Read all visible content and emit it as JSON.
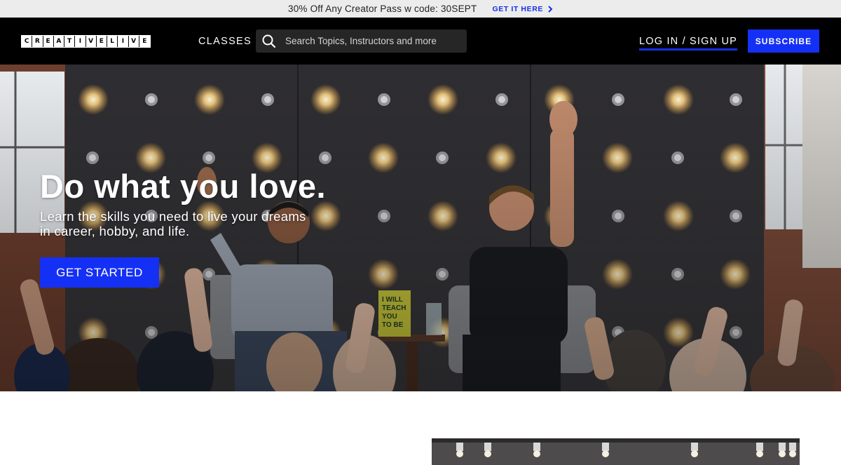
{
  "promo": {
    "text": "30% Off Any Creator Pass w code: 30SEPT",
    "link_label": "GET IT HERE"
  },
  "header": {
    "logo_letters": [
      "C",
      "R",
      "E",
      "A",
      "T",
      "I",
      "V",
      "E",
      "L",
      "I",
      "V",
      "E"
    ],
    "classes_label": "CLASSES",
    "search_placeholder": "Search Topics, Instructors and more",
    "login_label": "LOG IN / SIGN UP",
    "subscribe_label": "SUBSCRIBE"
  },
  "hero": {
    "title": "Do what you love.",
    "subtitle": "Learn the skills you need to live your dreams in career, hobby, and life.",
    "cta_label": "GET STARTED",
    "book_text": "I WILL TEACH YOU TO BE RICH"
  },
  "colors": {
    "accent": "#1530f5",
    "header_bg": "#000000",
    "promo_bg": "#ececec"
  },
  "icons": {
    "search": "search-icon",
    "chevron": "chevron-right-icon"
  }
}
